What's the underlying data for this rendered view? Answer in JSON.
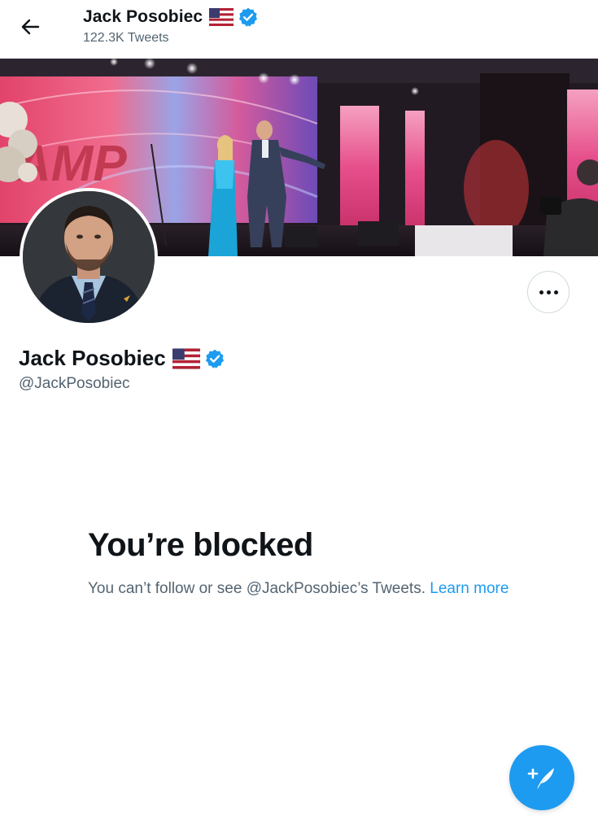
{
  "header": {
    "name": "Jack Posobiec",
    "tweet_count": "122.3K Tweets"
  },
  "banner": {
    "stage_text": "AMP"
  },
  "profile": {
    "name": "Jack Posobiec",
    "handle": "@JackPosobiec"
  },
  "blocked": {
    "title": "You’re blocked",
    "message": "You can’t follow or see @JackPosobiec’s Tweets. ",
    "link": "Learn more"
  },
  "icons": {
    "back": "back-arrow-icon",
    "flag": "us-flag-icon",
    "verified": "verified-badge-icon",
    "more": "more-options-icon",
    "compose": "compose-tweet-icon"
  },
  "colors": {
    "accent": "#1d9bf0",
    "text": "#0f1419",
    "secondary": "#536471"
  }
}
